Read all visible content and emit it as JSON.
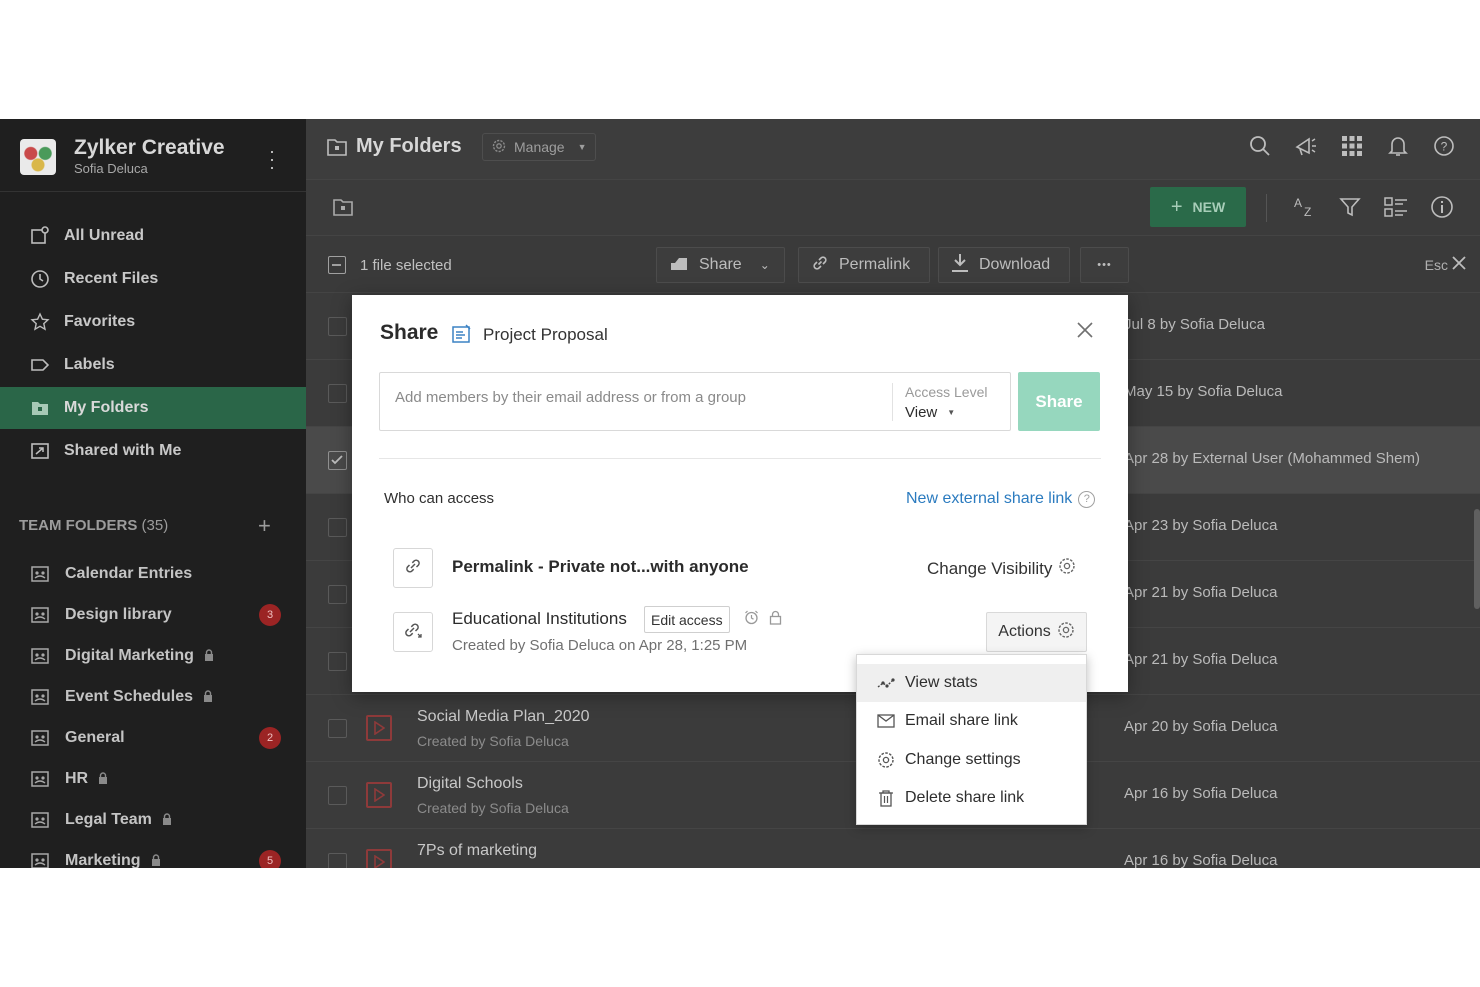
{
  "org": {
    "name": "Zylker Creative",
    "user": "Sofia Deluca"
  },
  "nav": [
    {
      "label": "All Unread",
      "icon": "all-unread-icon"
    },
    {
      "label": "Recent Files",
      "icon": "clock-icon"
    },
    {
      "label": "Favorites",
      "icon": "star-icon"
    },
    {
      "label": "Labels",
      "icon": "label-icon"
    },
    {
      "label": "My Folders",
      "icon": "folder-icon",
      "active": true
    },
    {
      "label": "Shared with Me",
      "icon": "shared-icon"
    }
  ],
  "team_folders": {
    "title": "TEAM FOLDERS",
    "count": "(35)",
    "items": [
      {
        "label": "Calendar Entries"
      },
      {
        "label": "Design library",
        "badge": "3"
      },
      {
        "label": "Digital Marketing",
        "locked": true
      },
      {
        "label": "Event Schedules",
        "locked": true
      },
      {
        "label": "General",
        "badge": "2"
      },
      {
        "label": "HR",
        "locked": true
      },
      {
        "label": "Legal Team",
        "locked": true
      },
      {
        "label": "Marketing",
        "locked": true,
        "badge": "5"
      }
    ]
  },
  "topbar": {
    "title": "My Folders",
    "manage_label": "Manage"
  },
  "toolbar": {
    "new_label": "NEW"
  },
  "selection": {
    "text": "1 file selected",
    "share_label": "Share",
    "permalink_label": "Permalink",
    "download_label": "Download",
    "more_label": "•••",
    "esc_label": "Esc"
  },
  "files": [
    {
      "name": "",
      "sub": "",
      "modified": "Jul 8 by Sofia Deluca"
    },
    {
      "name": "",
      "sub": "",
      "modified": "May 15 by Sofia Deluca"
    },
    {
      "name": "",
      "sub": "",
      "modified": "Apr 28 by External User (Mohammed Shem)",
      "selected": true
    },
    {
      "name": "",
      "sub": "",
      "modified": "Apr 23 by Sofia Deluca"
    },
    {
      "name": "",
      "sub": "",
      "modified": "Apr 21 by Sofia Deluca"
    },
    {
      "name": "",
      "sub": "",
      "modified": "Apr 21 by Sofia Deluca"
    },
    {
      "name": "Social Media Plan_2020",
      "sub": "Created by Sofia Deluca",
      "modified": "Apr 20 by Sofia Deluca"
    },
    {
      "name": "Digital Schools",
      "sub": "Created by Sofia Deluca",
      "modified": "Apr 16 by Sofia Deluca"
    },
    {
      "name": "7Ps of marketing",
      "sub": "",
      "modified": "Apr 16 by Sofia Deluca"
    }
  ],
  "share_modal": {
    "title": "Share",
    "document": "Project Proposal",
    "input_placeholder": "Add members by their email address or from a group",
    "access_level_label": "Access Level",
    "access_level_value": "View",
    "share_button": "Share",
    "who_can_access": "Who can access",
    "new_external_link": "New external share link",
    "permalink": {
      "name": "Permalink - Private not...with anyone",
      "action": "Change Visibility"
    },
    "external_link": {
      "name": "Educational Institutions",
      "edit_label": "Edit access",
      "created": "Created by Sofia Deluca on Apr 28, 1:25 PM",
      "actions_label": "Actions"
    }
  },
  "actions_menu": [
    {
      "label": "View stats",
      "icon": "stats-icon"
    },
    {
      "label": "Email share link",
      "icon": "mail-icon"
    },
    {
      "label": "Change settings",
      "icon": "gear-icon"
    },
    {
      "label": "Delete share link",
      "icon": "trash-icon"
    }
  ],
  "colors": {
    "sidebar_bg": "#1f1f1f",
    "active_nav": "#2a6648",
    "new_button": "#2a6a49",
    "share_button": "#96d7be",
    "link_blue": "#2b7bbf",
    "badge_red": "#9b2424"
  }
}
